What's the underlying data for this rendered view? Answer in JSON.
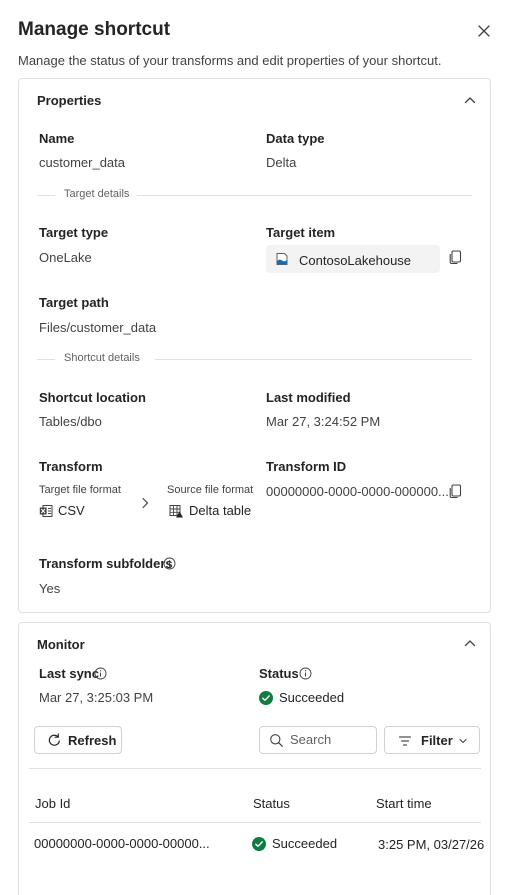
{
  "header": {
    "title": "Manage shortcut",
    "subtitle": "Manage the status of your transforms and edit properties of your shortcut."
  },
  "properties": {
    "title": "Properties",
    "name_label": "Name",
    "name_value": "customer_data",
    "data_type_label": "Data type",
    "data_type_value": "Delta",
    "target_details_divider": "Target details",
    "target_type_label": "Target type",
    "target_type_value": "OneLake",
    "target_item_label": "Target item",
    "target_item_value": "ContosoLakehouse",
    "target_path_label": "Target path",
    "target_path_value": "Files/customer_data",
    "shortcut_details_divider": "Shortcut details",
    "shortcut_location_label": "Shortcut location",
    "shortcut_location_value": "Tables/dbo",
    "last_modified_label": "Last modified",
    "last_modified_value": "Mar 27, 3:24:52 PM",
    "transform_label": "Transform",
    "target_file_format_label": "Target file format",
    "target_file_format_value": "CSV",
    "source_file_format_label": "Source file format",
    "source_file_format_value": "Delta table",
    "transform_id_label": "Transform ID",
    "transform_id_value": "00000000-0000-0000-000000...",
    "transform_subfolders_label": "Transform subfolders",
    "transform_subfolders_value": "Yes"
  },
  "monitor": {
    "title": "Monitor",
    "last_sync_label": "Last sync",
    "last_sync_value": "Mar 27, 3:25:03 PM",
    "status_label": "Status",
    "status_value": "Succeeded",
    "refresh_label": "Refresh",
    "search_placeholder": "Search",
    "filter_label": "Filter",
    "table": {
      "headers": [
        "Job Id",
        "Status",
        "Start time"
      ],
      "rows": [
        [
          "00000000-0000-0000-00000...",
          "Succeeded",
          "3:25 PM, 03/27/26"
        ]
      ]
    }
  },
  "colors": {
    "success": "#107c41",
    "border": "#e0e0e0",
    "lakehouse_icon": "#0f6cbd"
  }
}
